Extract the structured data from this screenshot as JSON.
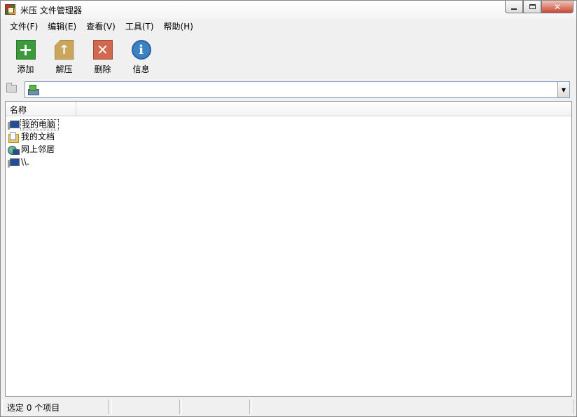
{
  "window": {
    "title": "米压 文件管理器",
    "controls": {
      "minimize": "",
      "maximize": "",
      "close": "✕"
    }
  },
  "menu": [
    "文件(F)",
    "编辑(E)",
    "查看(V)",
    "工具(T)",
    "帮助(H)"
  ],
  "toolbar": {
    "add": {
      "label": "添加",
      "icon": "add-icon"
    },
    "extract": {
      "label": "解压",
      "icon": "extract-icon"
    },
    "delete": {
      "label": "删除",
      "icon": "delete-icon"
    },
    "info": {
      "label": "信息",
      "icon": "info-icon"
    }
  },
  "address": {
    "value": ""
  },
  "list": {
    "columns": [
      "名称"
    ],
    "items": [
      {
        "label": "我的电脑",
        "icon": "computer-icon"
      },
      {
        "label": "我的文档",
        "icon": "documents-folder-icon"
      },
      {
        "label": "网上邻居",
        "icon": "network-icon"
      },
      {
        "label": "\\\\.",
        "icon": "computer-icon"
      }
    ]
  },
  "status": {
    "selection": "选定 0 个项目",
    "cell2": "",
    "cell3": "",
    "cell4": ""
  },
  "colors": {
    "accent": "#3b82c4",
    "add": "#3c9a3a",
    "delete": "#cf6a50",
    "extract": "#c9a55e"
  }
}
